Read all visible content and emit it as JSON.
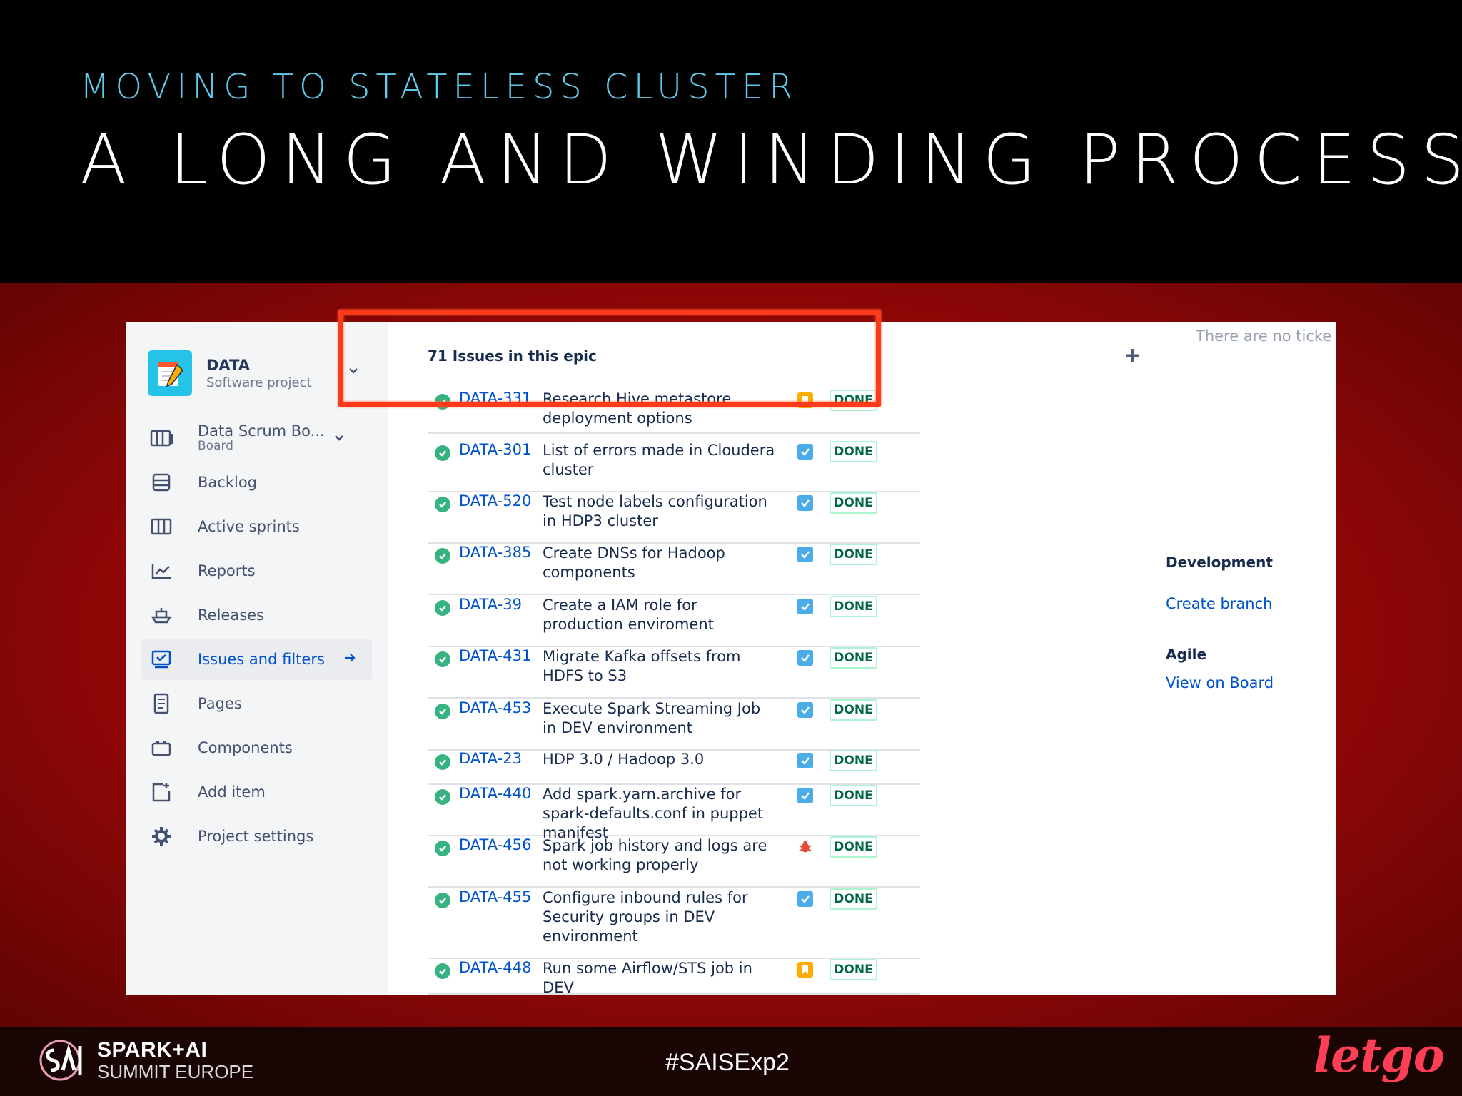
{
  "slide": {
    "eyebrow": "MOVING TO STATELESS CLUSTER",
    "headline": "A LONG AND WINDING PROCESS",
    "hashtag": "#SAISExp2",
    "brand_line1": "SPARK+AI",
    "brand_line2": "SUMMIT EUROPE",
    "sponsor": "letgo",
    "colors": {
      "eyebrow": "#5ec9e8",
      "red_band": "#b00a0a",
      "highlight": "#ff3a1a",
      "sponsor": "#ff3f55"
    }
  },
  "sidebar": {
    "project": {
      "name": "DATA",
      "type": "Software project",
      "icon": "project-avatar-icon"
    },
    "board": {
      "label": "Data Scrum Bo...",
      "sub": "Board",
      "icon": "board-icon"
    },
    "items": [
      {
        "label": "Backlog",
        "icon": "backlog-icon"
      },
      {
        "label": "Active sprints",
        "icon": "columns-icon"
      },
      {
        "label": "Reports",
        "icon": "chart-icon"
      },
      {
        "label": "Releases",
        "icon": "ship-icon"
      },
      {
        "label": "Issues and filters",
        "icon": "issues-icon",
        "active": true
      },
      {
        "label": "Pages",
        "icon": "page-icon"
      },
      {
        "label": "Components",
        "icon": "component-icon"
      },
      {
        "label": "Add item",
        "icon": "add-item-icon"
      },
      {
        "label": "Project settings",
        "icon": "gear-icon"
      }
    ]
  },
  "main": {
    "issues_title": "71 Issues in this epic",
    "no_tickets": "There are no ticke",
    "issues": [
      {
        "key": "DATA-331",
        "summary": "Research Hive metastore deployment options",
        "type": "story",
        "status": "DONE"
      },
      {
        "key": "DATA-301",
        "summary": "List of errors made in Cloudera cluster",
        "type": "task",
        "status": "DONE"
      },
      {
        "key": "DATA-520",
        "summary": "Test node labels configuration in HDP3 cluster",
        "type": "task",
        "status": "DONE"
      },
      {
        "key": "DATA-385",
        "summary": "Create DNSs for Hadoop components",
        "type": "task",
        "status": "DONE"
      },
      {
        "key": "DATA-39",
        "summary": "Create a IAM role for production enviroment",
        "type": "task",
        "status": "DONE"
      },
      {
        "key": "DATA-431",
        "summary": "Migrate Kafka offsets from HDFS to S3",
        "type": "task",
        "status": "DONE"
      },
      {
        "key": "DATA-453",
        "summary": "Execute Spark Streaming Job in DEV environment",
        "type": "task",
        "status": "DONE"
      },
      {
        "key": "DATA-23",
        "summary": "HDP 3.0 / Hadoop 3.0",
        "type": "task",
        "status": "DONE"
      },
      {
        "key": "DATA-440",
        "summary": "Add spark.yarn.archive for spark-defaults.conf in puppet manifest",
        "type": "task",
        "status": "DONE"
      },
      {
        "key": "DATA-456",
        "summary": "Spark job history and logs are not working properly",
        "type": "bug",
        "status": "DONE"
      },
      {
        "key": "DATA-455",
        "summary": "Configure inbound rules for Security groups in DEV environment",
        "type": "task",
        "status": "DONE"
      },
      {
        "key": "DATA-448",
        "summary": "Run some Airflow/STS job in DEV",
        "type": "story",
        "status": "DONE"
      }
    ]
  },
  "right_panel": {
    "development_title": "Development",
    "create_branch": "Create branch",
    "agile_title": "Agile",
    "view_on_board": "View on Board"
  }
}
